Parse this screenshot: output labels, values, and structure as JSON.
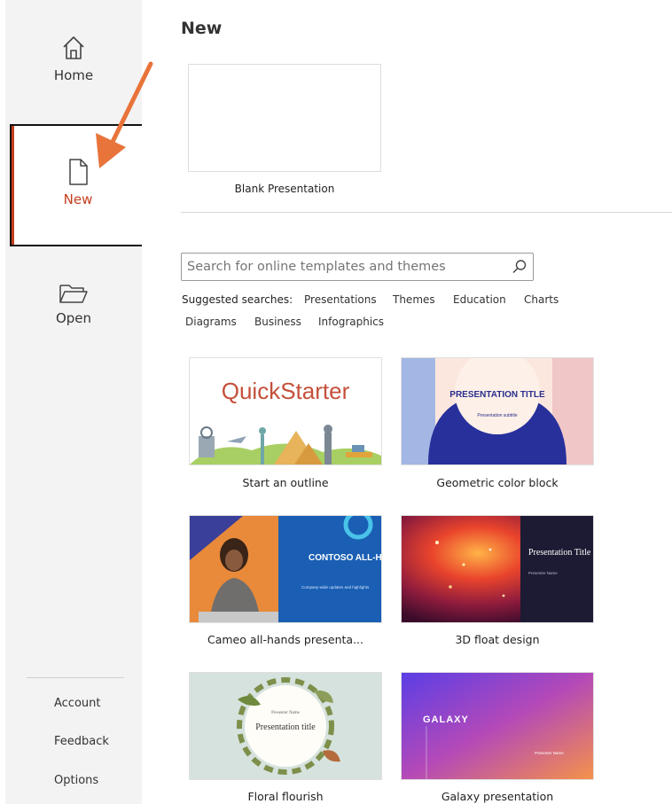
{
  "sidebar": {
    "home_label": "Home",
    "new_label": "New",
    "open_label": "Open",
    "account_label": "Account",
    "feedback_label": "Feedback",
    "options_label": "Options"
  },
  "main": {
    "title": "New",
    "blank_label": "Blank Presentation",
    "search_placeholder": "Search for online templates and themes",
    "suggested_label": "Suggested searches:",
    "suggestions": [
      "Presentations",
      "Themes",
      "Education",
      "Charts",
      "Diagrams",
      "Business",
      "Infographics"
    ],
    "templates": [
      {
        "label": "Start an outline",
        "thumb_text": "QuickStarter"
      },
      {
        "label": "Geometric color block",
        "thumb_text": "PRESENTATION TITLE",
        "thumb_sub": "Presentation subtitle"
      },
      {
        "label": "Cameo all-hands presenta...",
        "thumb_text": "CONTOSO ALL-HANDS",
        "thumb_sub": "Company-wide updates and highlights"
      },
      {
        "label": "3D float design",
        "thumb_text": "Presentation Title",
        "thumb_sub": "Presenter Name"
      },
      {
        "label": "Floral flourish",
        "thumb_text": "Presentation title",
        "thumb_sub": "Presenter Name"
      },
      {
        "label": "Galaxy presentation",
        "thumb_text": "GALAXY",
        "thumb_sub": "Presenter Name"
      }
    ]
  },
  "colors": {
    "accent": "#c43e1c",
    "arrow": "#e8743b"
  },
  "icons": [
    "home-icon",
    "new-document-icon",
    "open-folder-icon",
    "search-icon",
    "arrow-annotation"
  ]
}
